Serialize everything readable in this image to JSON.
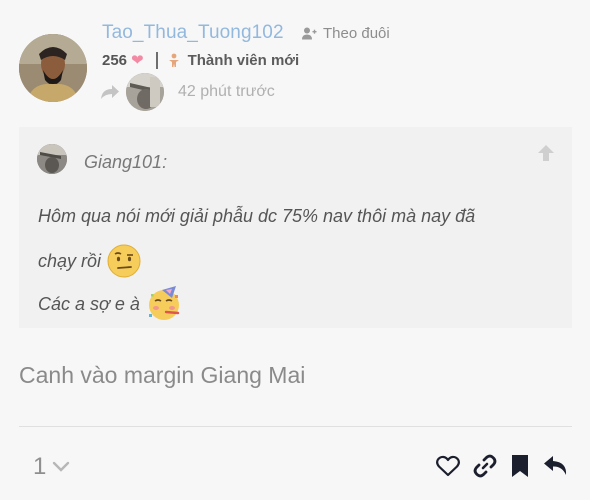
{
  "post": {
    "username": "Tao_Thua_Tuong102",
    "follow_label": "Theo đuôi",
    "likes_received": "256",
    "rank_label": "Thành viên mới",
    "posted_ago": "42 phút trước",
    "quote": {
      "author": "Giang101:",
      "line1": "Hôm qua nói mới giải phẫu dc 75% nav thôi mà nay đã",
      "line2": "chạy rồi",
      "line3": "Các a sợ e à"
    },
    "text": "Canh vào margin Giang Mai",
    "like_count": "1"
  },
  "colors": {
    "username": "#93b8de",
    "heart": "#f28aa3",
    "action_icons": "#1b1f2e"
  }
}
